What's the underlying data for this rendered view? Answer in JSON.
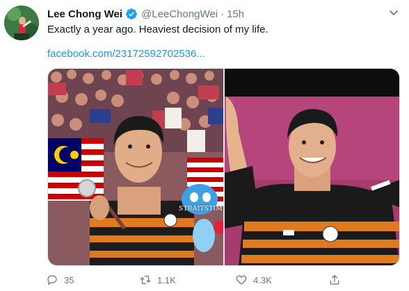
{
  "tweet": {
    "author_name": "Lee Chong Wei",
    "handle": "@LeeChongWei",
    "separator": "·",
    "time": "15h",
    "text": "Exactly a year ago. Heaviest decision of my life.",
    "link": "facebook.com/23172592702536..."
  },
  "media": {
    "watermark": "STRAITSTIMES"
  },
  "actions": {
    "replies": "35",
    "retweets": "1.1K",
    "likes": "4.3K"
  },
  "icons": {
    "verified": "verified-badge-icon",
    "more": "chevron-down-icon",
    "reply": "reply-icon",
    "retweet": "retweet-icon",
    "like": "heart-icon",
    "share": "share-icon"
  },
  "colors": {
    "verified_blue": "#1da1f2",
    "link_blue": "#1b95e0",
    "muted_gray": "#657786"
  }
}
